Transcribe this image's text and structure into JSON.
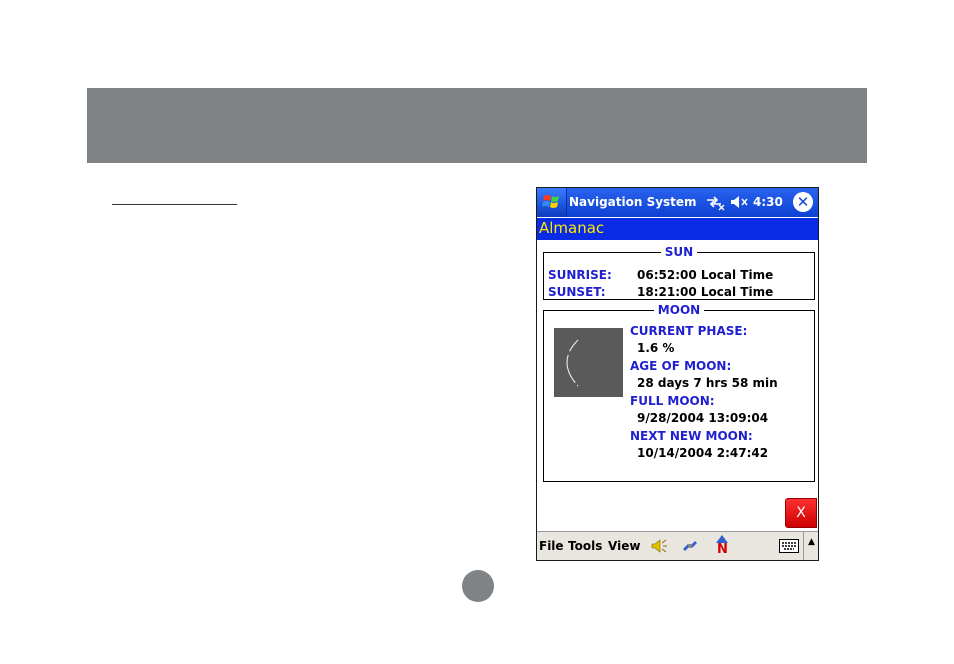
{
  "device": {
    "titlebar": {
      "title": "Navigation System",
      "time": "4:30",
      "close_glyph": "✕",
      "icons": [
        "windows-start-icon",
        "connectivity-icon",
        "volume-icon",
        "close-icon"
      ]
    },
    "app_title": "Almanac",
    "sun": {
      "legend": "SUN",
      "sunrise_label": "SUNRISE:",
      "sunrise_value": "06:52:00 Local Time",
      "sunset_label": "SUNSET:",
      "sunset_value": "18:21:00 Local Time"
    },
    "moon": {
      "legend": "MOON",
      "current_phase_label": "CURRENT PHASE:",
      "current_phase_value": "1.6 %",
      "age_label": "AGE OF MOON:",
      "age_value": "28 days 7 hrs 58 min",
      "full_moon_label": "FULL MOON:",
      "full_moon_value": "9/28/2004 13:09:04",
      "next_new_moon_label": "NEXT NEW MOON:",
      "next_new_moon_value": "10/14/2004 2:47:42"
    },
    "close_button_label": "X",
    "menubar": {
      "file": "File",
      "tools": "Tools",
      "view": "View",
      "icons": [
        "speaker-icon",
        "satellite-icon",
        "north-arrow-icon",
        "keyboard-icon",
        "sip-arrow-icon"
      ],
      "north_letter": "N",
      "sip_arrow_glyph": "▲"
    }
  },
  "colors": {
    "band": "#7f8385",
    "titlebar": "#0d41d3",
    "appbar": "#0a2be6",
    "app_title_text": "#ffe800",
    "label_blue": "#1f1fd0",
    "close_red": "#e00000"
  }
}
